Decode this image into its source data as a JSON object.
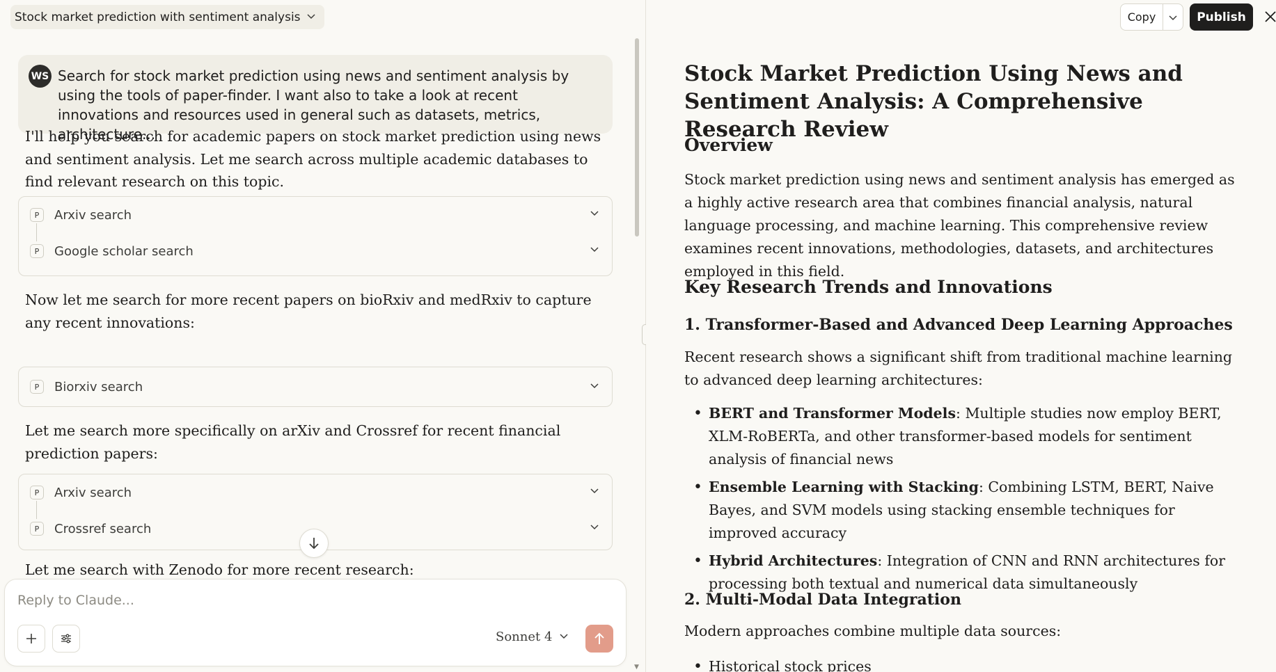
{
  "header": {
    "conversation_title": "Stock market prediction with sentiment analysis"
  },
  "chat": {
    "user_message": {
      "avatar_initials": "WS",
      "text": "Search for stock market prediction using news and sentiment analysis by using the tools of paper-finder. I want also to take a look at recent innovations and resources used in general such as datasets, metrics, architecture..."
    },
    "assistant_messages": [
      "I'll help you search for academic papers on stock market prediction using news and sentiment analysis. Let me search across multiple academic databases to find relevant research on this topic.",
      "Now let me search for more recent papers on bioRxiv and medRxiv to capture any recent innovations:",
      "Let me search more specifically on arXiv and Crossref for recent financial prediction papers:",
      "Let me search with Zenodo for more recent research:"
    ],
    "tool_groups": [
      [
        {
          "badge": "P",
          "label": "Arxiv search"
        },
        {
          "badge": "P",
          "label": "Google scholar search"
        }
      ],
      [
        {
          "badge": "P",
          "label": "Biorxiv search"
        }
      ],
      [
        {
          "badge": "P",
          "label": "Arxiv search"
        },
        {
          "badge": "P",
          "label": "Crossref search"
        }
      ]
    ]
  },
  "composer": {
    "placeholder": "Reply to Claude...",
    "model": "Sonnet 4"
  },
  "artifact": {
    "copy_label": "Copy",
    "publish_label": "Publish",
    "title": "Stock Market Prediction Using News and Sentiment Analysis: A Comprehensive Research Review",
    "overview_heading": "Overview",
    "overview_text": "Stock market prediction using news and sentiment analysis has emerged as a highly active research area that combines financial analysis, natural language processing, and machine learning. This comprehensive review examines recent innovations, methodologies, datasets, and architectures employed in this field.",
    "trends_heading": "Key Research Trends and Innovations",
    "section1_heading": "1. Transformer-Based and Advanced Deep Learning Approaches",
    "section1_intro": "Recent research shows a significant shift from traditional machine learning to advanced deep learning architectures:",
    "section1_bullets": [
      {
        "term": "BERT and Transformer Models",
        "text": ": Multiple studies now employ BERT, XLM-RoBERTa, and other transformer-based models for sentiment analysis of financial news"
      },
      {
        "term": "Ensemble Learning with Stacking",
        "text": ": Combining LSTM, BERT, Naive Bayes, and SVM models using stacking ensemble techniques for improved accuracy"
      },
      {
        "term": "Hybrid Architectures",
        "text": ": Integration of CNN and RNN architectures for processing both textual and numerical data simultaneously"
      }
    ],
    "section2_heading": "2. Multi-Modal Data Integration",
    "section2_intro": "Modern approaches combine multiple data sources:",
    "section2_bullets": [
      "Historical stock prices"
    ]
  },
  "theme": {
    "background": "#faf9f5",
    "surface": "#f0eee6",
    "send_accent": "#e29c8a",
    "publish_bg": "#1f1e1d"
  }
}
